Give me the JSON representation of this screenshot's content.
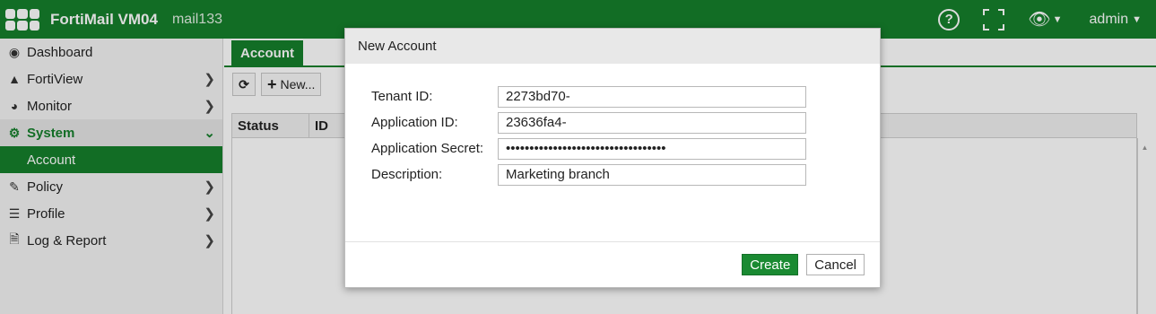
{
  "header": {
    "product": "FortiMail VM04",
    "hostname": "mail133",
    "help_icon": "?",
    "user": "admin"
  },
  "sidebar": {
    "items": [
      {
        "label": "Dashboard",
        "icon": "dashboard-icon"
      },
      {
        "label": "FortiView",
        "icon": "chart-icon"
      },
      {
        "label": "Monitor",
        "icon": "pie-icon"
      },
      {
        "label": "System",
        "icon": "gear-icon"
      },
      {
        "label": "Account"
      },
      {
        "label": "Policy",
        "icon": "policy-icon"
      },
      {
        "label": "Profile",
        "icon": "list-icon"
      },
      {
        "label": "Log & Report",
        "icon": "document-icon"
      }
    ]
  },
  "main": {
    "tab": "Account",
    "toolbar": {
      "new_label": "New..."
    },
    "columns": [
      "Status",
      "ID"
    ]
  },
  "dialog": {
    "title": "New Account",
    "fields": [
      {
        "label": "Tenant ID:",
        "value": "2273bd70-"
      },
      {
        "label": "Application ID:",
        "value": "23636fa4-"
      },
      {
        "label": "Application Secret:",
        "value": "••••••••••••••••••••••••••••••••••"
      },
      {
        "label": "Description:",
        "value": "Marketing branch"
      }
    ],
    "create_label": "Create",
    "cancel_label": "Cancel"
  },
  "colors": {
    "brand_green": "#167f2c",
    "overlay": "rgba(0,0,0,0.14)"
  }
}
